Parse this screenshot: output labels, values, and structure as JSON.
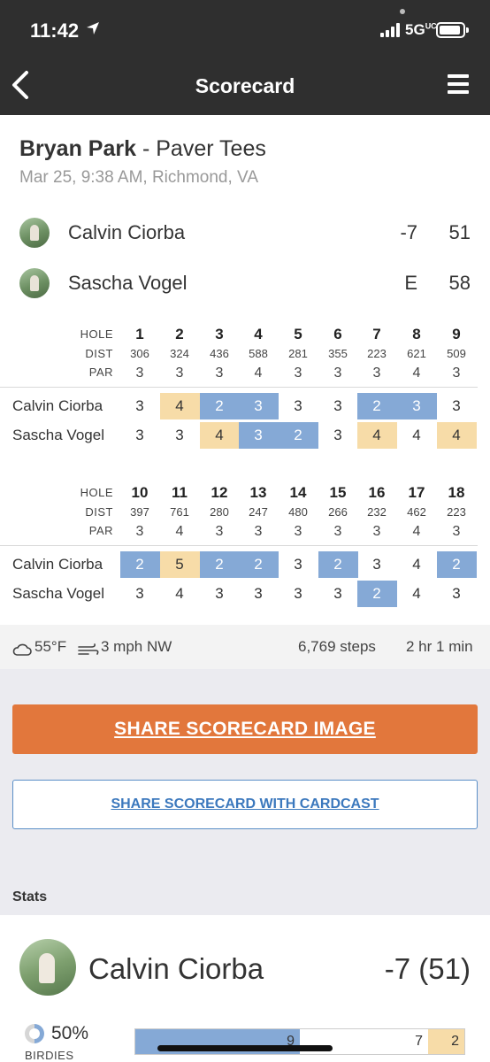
{
  "status_bar": {
    "time": "11:42",
    "network": "5G",
    "network_superscript": "UC"
  },
  "nav": {
    "title": "Scorecard",
    "back_icon": "chevron-left-icon",
    "menu_icon": "hamburger-menu-icon"
  },
  "course": {
    "name": "Bryan Park",
    "separator": " - ",
    "tees": "Paver Tees",
    "subtitle": "Mar 25, 9:38 AM, Richmond, VA"
  },
  "players": [
    {
      "name": "Calvin Ciorba",
      "to_par": "-7",
      "total": "51"
    },
    {
      "name": "Sascha Vogel",
      "to_par": "E",
      "total": "58"
    }
  ],
  "scorecard": {
    "labels": {
      "hole": "HOLE",
      "dist": "DIST",
      "par": "PAR"
    },
    "front": {
      "holes": [
        "1",
        "2",
        "3",
        "4",
        "5",
        "6",
        "7",
        "8",
        "9"
      ],
      "dist": [
        "306",
        "324",
        "436",
        "588",
        "281",
        "355",
        "223",
        "621",
        "509"
      ],
      "par": [
        "3",
        "3",
        "3",
        "4",
        "3",
        "3",
        "3",
        "4",
        "3"
      ],
      "scores": [
        {
          "name": "Calvin Ciorba",
          "values": [
            "3",
            "4",
            "2",
            "3",
            "3",
            "3",
            "2",
            "3",
            "3"
          ]
        },
        {
          "name": "Sascha Vogel",
          "values": [
            "3",
            "3",
            "4",
            "3",
            "2",
            "3",
            "4",
            "4",
            "4"
          ]
        }
      ]
    },
    "back": {
      "holes": [
        "10",
        "11",
        "12",
        "13",
        "14",
        "15",
        "16",
        "17",
        "18"
      ],
      "dist": [
        "397",
        "761",
        "280",
        "247",
        "480",
        "266",
        "232",
        "462",
        "223"
      ],
      "par": [
        "3",
        "4",
        "3",
        "3",
        "3",
        "3",
        "3",
        "4",
        "3"
      ],
      "scores": [
        {
          "name": "Calvin Ciorba",
          "values": [
            "2",
            "5",
            "2",
            "2",
            "3",
            "2",
            "3",
            "4",
            "2"
          ]
        },
        {
          "name": "Sascha Vogel",
          "values": [
            "3",
            "4",
            "3",
            "3",
            "3",
            "3",
            "2",
            "4",
            "3"
          ]
        }
      ]
    },
    "colors": {
      "birdie": "#85a9d6",
      "bogey": "#f7dca8"
    }
  },
  "conditions": {
    "temperature": "55°F",
    "wind": "3 mph NW",
    "steps": "6,769 steps",
    "duration": "2 hr 1 min",
    "weather_icon": "cloud-icon",
    "wind_icon": "wind-icon"
  },
  "actions": {
    "share_image": "SHARE SCORECARD IMAGE",
    "share_cardcast": "SHARE SCORECARD WITH CARDCAST",
    "accent_color": "#e2773c",
    "link_color": "#3b78bd"
  },
  "stats": {
    "section_label": "Stats",
    "player_name": "Calvin Ciorba",
    "player_score": "-7 (51)",
    "birdie_pct_label": "50%",
    "birdie_pct": 50,
    "birdie_label": "BIRDIES",
    "distribution": [
      {
        "value": 9,
        "label": "9",
        "color": "#85a9d6"
      },
      {
        "value": 7,
        "label": "7",
        "color": "#ffffff"
      },
      {
        "value": 2,
        "label": "2",
        "color": "#f7dca8"
      }
    ]
  }
}
